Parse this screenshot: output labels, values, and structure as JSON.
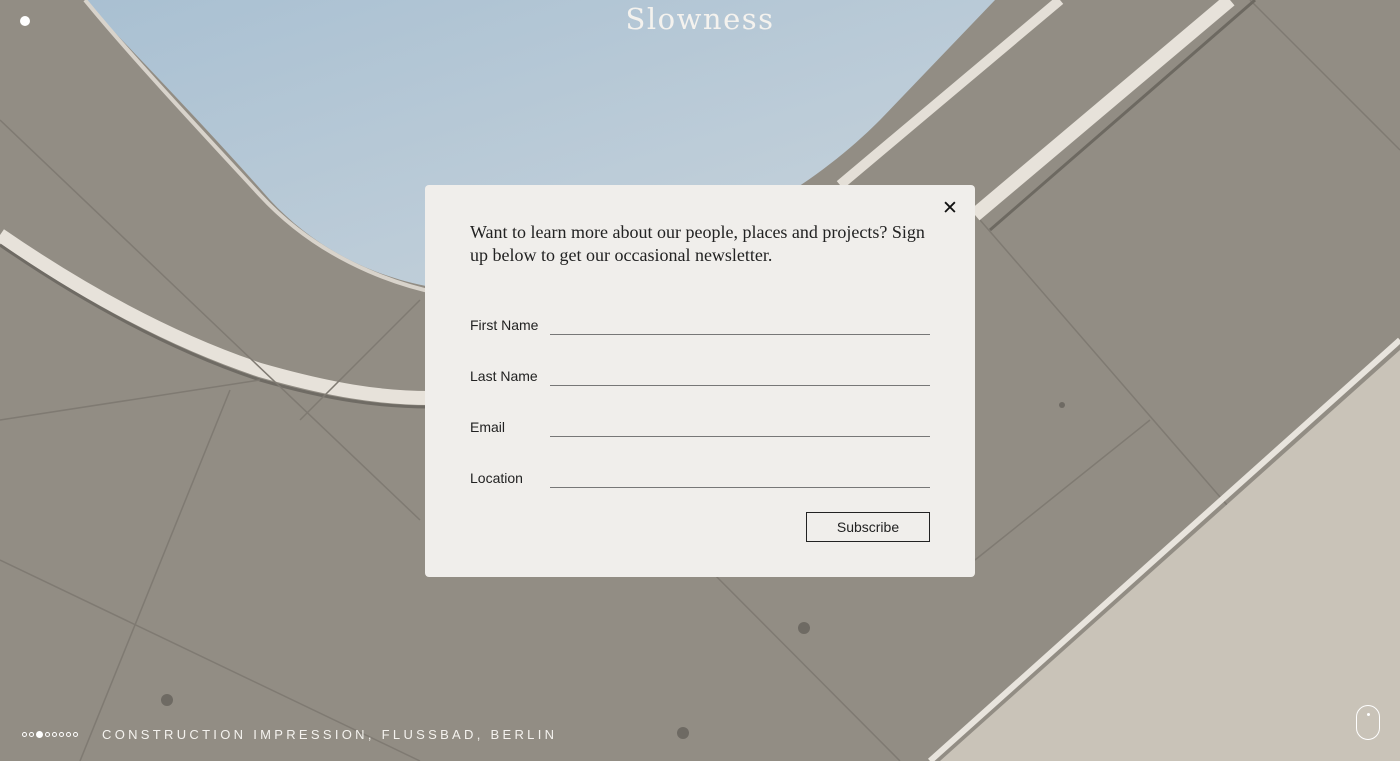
{
  "header": {
    "site_title": "Slowness"
  },
  "newsletter_modal": {
    "close_icon": "close-icon",
    "intro_text": "Want to learn more about our people, places and projects? Sign up below to get our occasional newsletter.",
    "fields": [
      {
        "label": "First Name",
        "value": ""
      },
      {
        "label": "Last Name",
        "value": ""
      },
      {
        "label": "Email",
        "value": ""
      },
      {
        "label": "Location",
        "value": ""
      }
    ],
    "subscribe_label": "Subscribe"
  },
  "slideshow": {
    "total_slides": 8,
    "active_slide": 3,
    "caption": "CONSTRUCTION IMPRESSION, FLUSSBAD, BERLIN"
  },
  "scroll_indicator": "mouse-icon",
  "colors": {
    "modal_background": "#f0eeeb",
    "sky": "#b5c7d4",
    "concrete": "#8f8a81"
  }
}
